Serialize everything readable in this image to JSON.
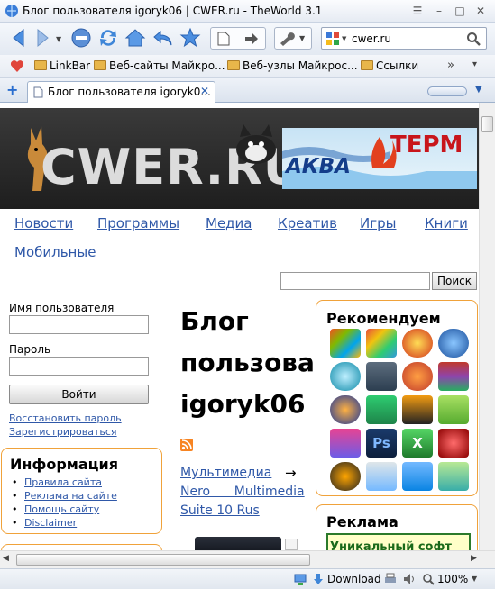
{
  "window": {
    "title": "Блог пользователя igoryk06 | CWER.ru - TheWorld 3.1"
  },
  "toolbar": {
    "address": "cwer.ru"
  },
  "favorites": [
    {
      "label": "LinkBar"
    },
    {
      "label": "Веб-сайты Майкро..."
    },
    {
      "label": "Веб-узлы Майкрос..."
    },
    {
      "label": "Ссылки"
    }
  ],
  "tab": {
    "label": "Блог пользователя igoryk0..."
  },
  "site": {
    "logo": "CWER.RU",
    "banner_left": "АКВА",
    "banner_right": "ТЕРМ",
    "nav": [
      "Новости",
      "Программы",
      "Медиа",
      "Креатив",
      "Игры",
      "Книги",
      "Мобильные"
    ],
    "search_button": "Поиск",
    "login": {
      "username_label": "Имя пользователя",
      "password_label": "Пароль",
      "submit": "Войти",
      "restore": "Восстановить пароль",
      "register": "Зарегистрироваться"
    },
    "info": {
      "title": "Информация",
      "links": [
        "Правила сайта",
        "Реклама на сайте",
        "Помощь сайту",
        "Disclaimer"
      ]
    },
    "blog_title": "Блог\nпользова\nigoryk06",
    "post": {
      "category": "Мультимедиа",
      "arrow": "→",
      "title_line1": "Nero      Multimedia",
      "title_line2": "Suite 10 Rus"
    },
    "recommend_title": "Рекомендуем",
    "ad_title": "Реклама",
    "ad_text": "Уникальный софт"
  },
  "status": {
    "download": "Download",
    "zoom": "100%"
  },
  "colors": {
    "link": "#2f58a8",
    "accent_border": "#f0a23a"
  }
}
